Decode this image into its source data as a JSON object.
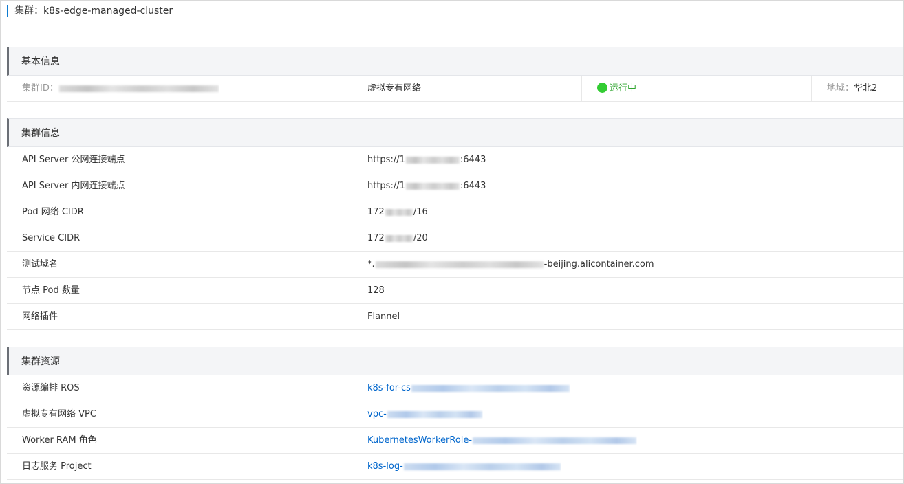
{
  "page": {
    "title": "集群：k8s-edge-managed-cluster"
  },
  "basic": {
    "header": "基本信息",
    "cluster_id_label": "集群ID：",
    "network_type": "虚拟专有网络",
    "status": "运行中",
    "region_label": "地域：",
    "region_value": "华北2"
  },
  "cluster_info": {
    "header": "集群信息",
    "rows": [
      {
        "label": "API Server 公网连接端点",
        "prefix": "https://1",
        "suffix": ":6443"
      },
      {
        "label": "API Server 内网连接端点",
        "prefix": "https://1",
        "suffix": ":6443"
      },
      {
        "label": "Pod 网络 CIDR",
        "prefix": "172",
        "suffix": "/16"
      },
      {
        "label": "Service CIDR",
        "prefix": "172",
        "suffix": "/20"
      },
      {
        "label": "测试域名",
        "prefix": "*.",
        "suffix": "-beijing.alicontainer.com"
      },
      {
        "label": "节点 Pod 数量",
        "prefix": "128",
        "suffix": ""
      },
      {
        "label": "网络插件",
        "prefix": "Flannel",
        "suffix": ""
      }
    ]
  },
  "resources": {
    "header": "集群资源",
    "rows": [
      {
        "label": "资源编排 ROS",
        "prefix": "k8s-for-cs"
      },
      {
        "label": "虚拟专有网络 VPC",
        "prefix": "vpc-"
      },
      {
        "label": "Worker RAM 角色",
        "prefix": "KubernetesWorkerRole-"
      },
      {
        "label": "日志服务 Project",
        "prefix": "k8s-log-"
      }
    ]
  },
  "colors": {
    "link": "#0066cc",
    "status_dot": "#33cc33",
    "status_text": "#2fa52f",
    "accent_bar": "#0d7bd0"
  }
}
